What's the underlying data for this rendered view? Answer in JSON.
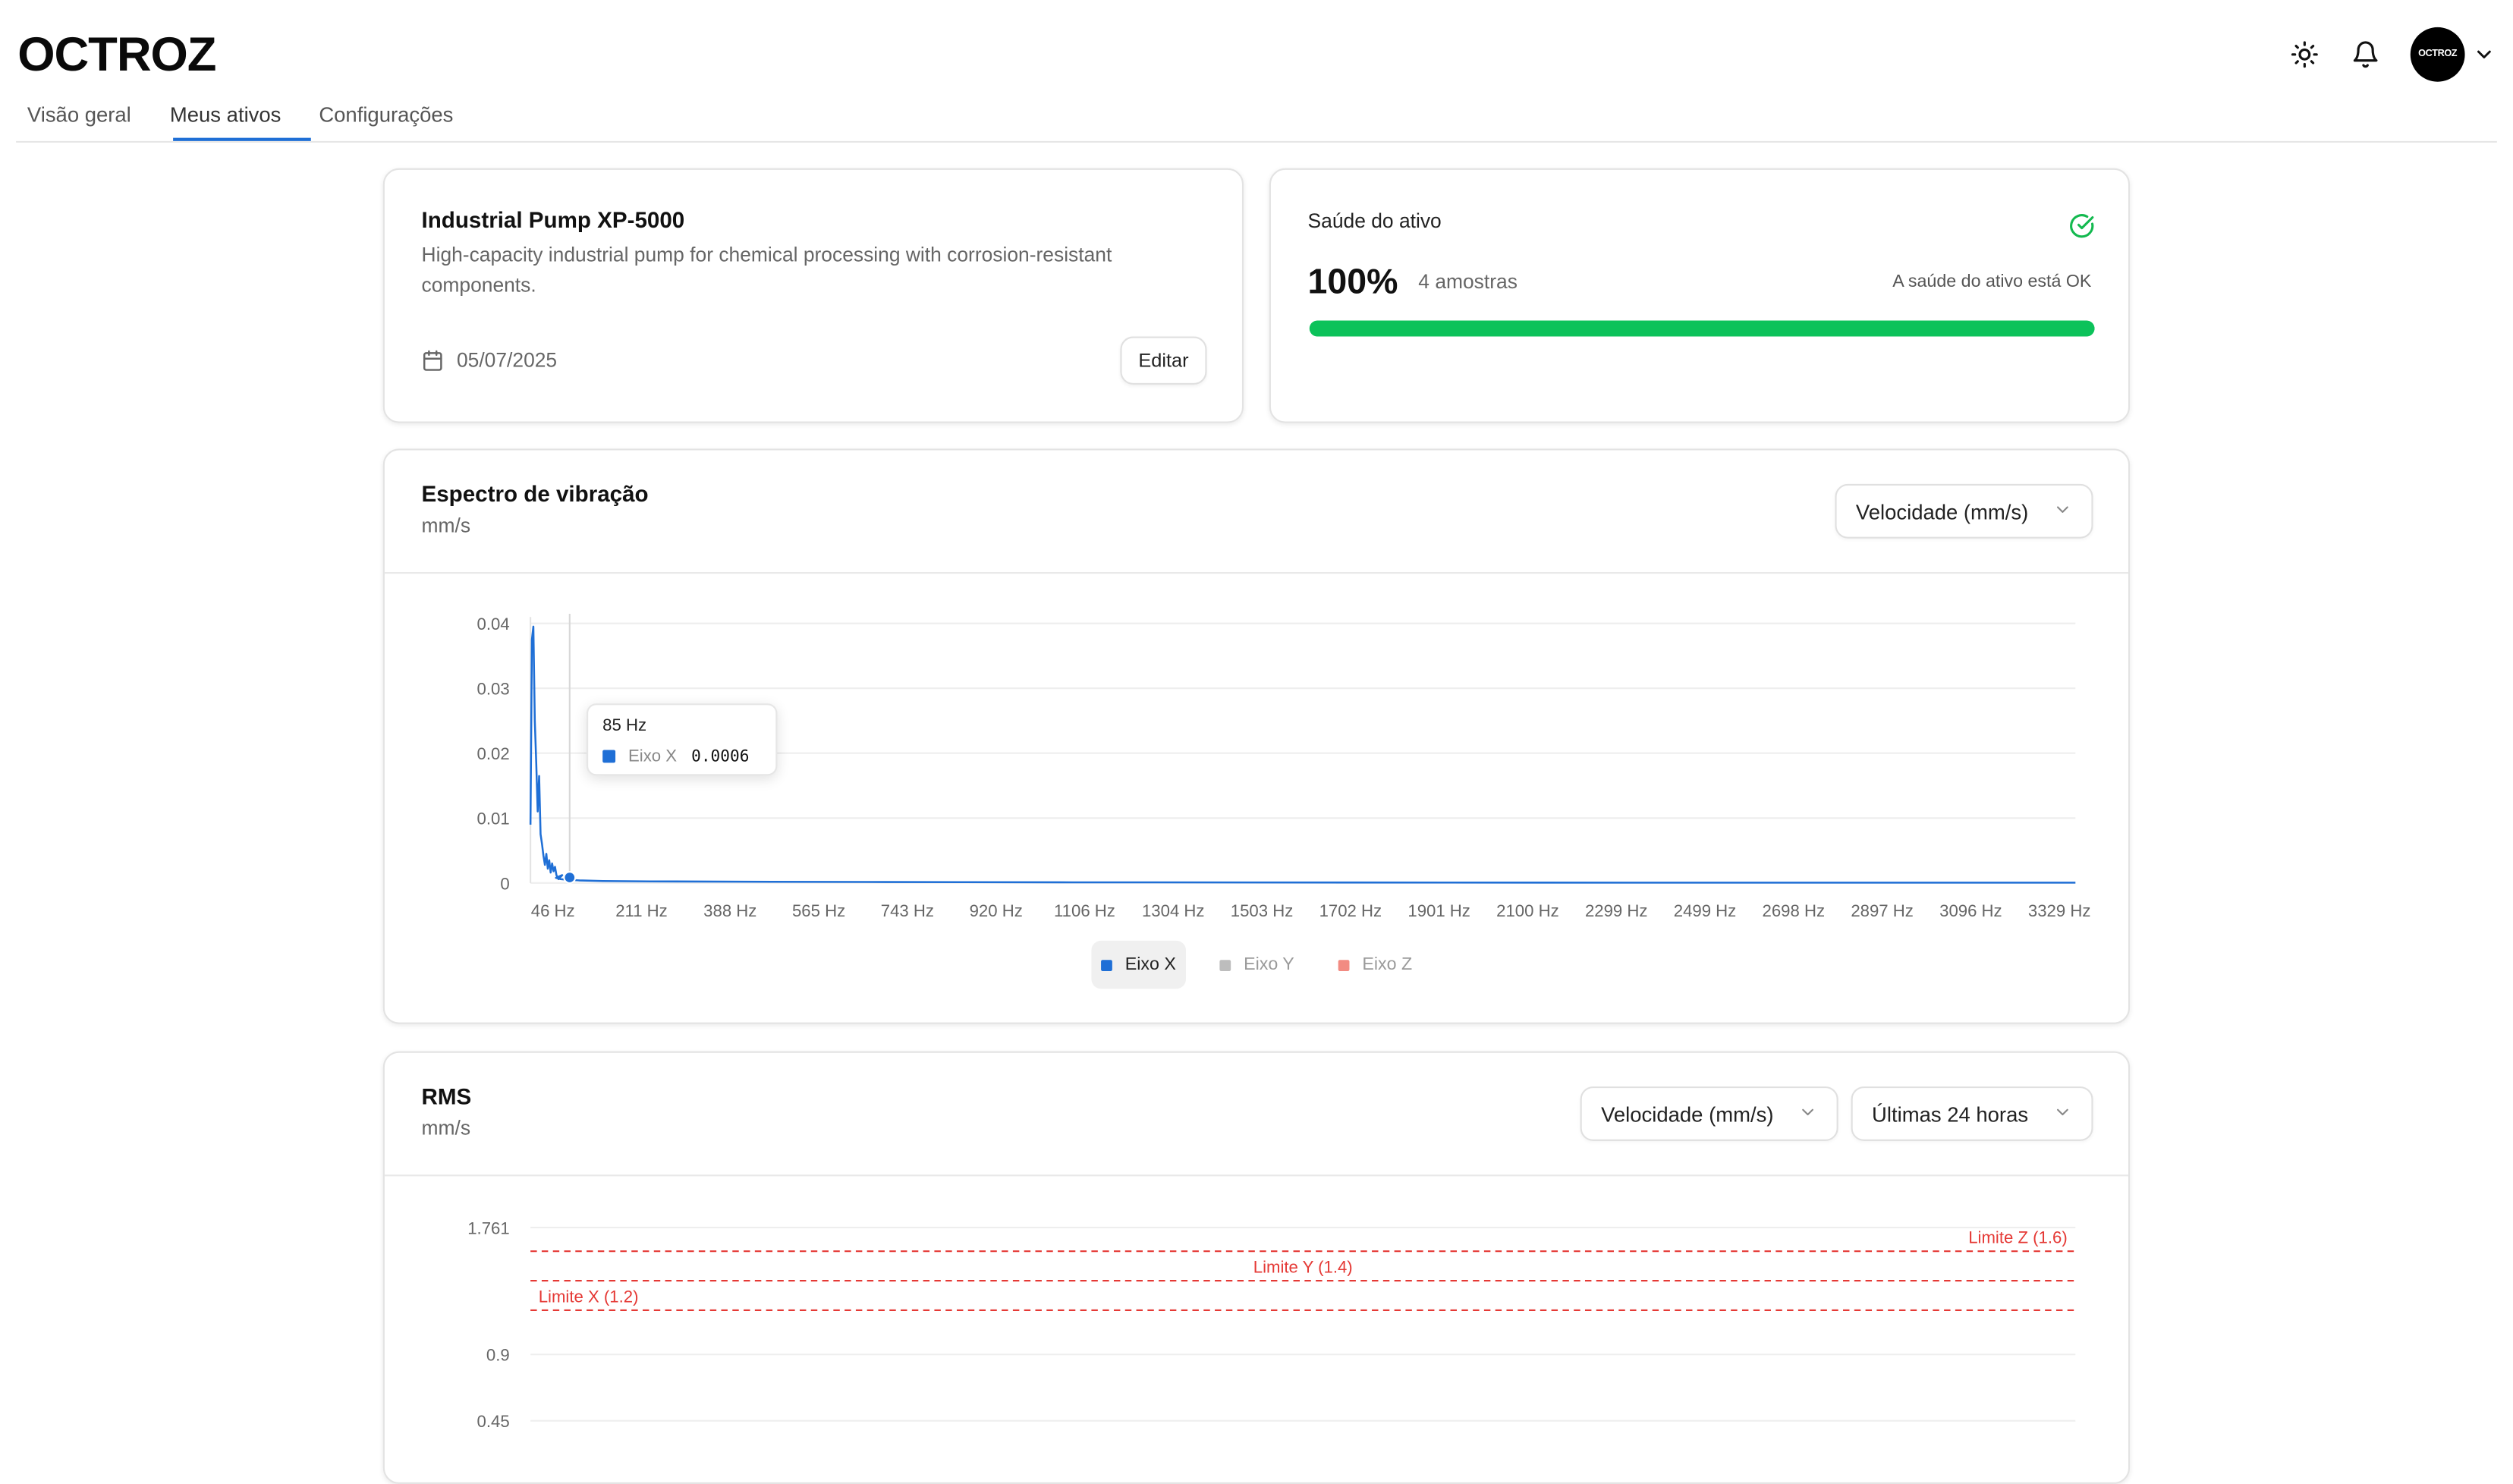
{
  "brand": {
    "logo": "OCTROZ",
    "avatar_text": "OCTROZ"
  },
  "header": {
    "icons": [
      "sun-icon",
      "bell-icon",
      "chevron-down-icon"
    ]
  },
  "tabs": [
    {
      "label": "Visão geral",
      "active": false
    },
    {
      "label": "Meus ativos",
      "active": true
    },
    {
      "label": "Configurações",
      "active": false
    }
  ],
  "asset": {
    "name": "Industrial Pump XP-5000",
    "description": "High-capacity industrial pump for chemical processing with corrosion-resistant components.",
    "date": "05/07/2025",
    "edit_label": "Editar"
  },
  "health": {
    "title": "Saúde do ativo",
    "percent_label": "100%",
    "percent": 100,
    "samples": "4 amostras",
    "status": "A saúde do ativo está OK",
    "color": "#0cc25a"
  },
  "spectrum": {
    "title": "Espectro de vibração",
    "unit": "mm/s",
    "select_value": "Velocidade (mm/s)",
    "tooltip": {
      "title": "85 Hz",
      "series": "Eixo X",
      "value": "0.0006"
    },
    "legend": [
      {
        "name": "Eixo X",
        "color": "#1f6fd6",
        "active": true
      },
      {
        "name": "Eixo Y",
        "color": "#bdbdbd",
        "active": false
      },
      {
        "name": "Eixo Z",
        "color": "#f28b82",
        "active": false
      }
    ]
  },
  "rms": {
    "title": "RMS",
    "unit": "mm/s",
    "metric_select": "Velocidade (mm/s)",
    "range_select": "Últimas 24 horas"
  },
  "chart_data": [
    {
      "type": "line",
      "x_tick_labels": [
        "46 Hz",
        "211 Hz",
        "388 Hz",
        "565 Hz",
        "743 Hz",
        "920 Hz",
        "1106 Hz",
        "1304 Hz",
        "1503 Hz",
        "1702 Hz",
        "1901 Hz",
        "2100 Hz",
        "2299 Hz",
        "2499 Hz",
        "2698 Hz",
        "2897 Hz",
        "3096 Hz",
        "3329 Hz"
      ],
      "y_ticks": [
        0,
        0.01,
        0.02,
        0.03,
        0.04
      ],
      "y_tick_labels": [
        "0",
        "0.01",
        "0.02",
        "0.03",
        "0.04"
      ],
      "xlim": [
        46,
        3329
      ],
      "ylim": [
        0,
        0.04
      ],
      "series": [
        {
          "name": "Eixo X",
          "color": "#1f6fd6",
          "x": [
            46,
            48,
            50,
            52,
            54,
            56,
            58,
            60,
            62,
            64,
            66,
            68,
            70,
            72,
            74,
            76,
            78,
            80,
            82,
            85,
            90,
            100,
            110,
            125,
            150,
            200,
            300,
            500,
            800,
            1200,
            1800,
            2500,
            3329
          ],
          "y": [
            0.009,
            0.0375,
            0.0395,
            0.025,
            0.0185,
            0.011,
            0.0165,
            0.0075,
            0.006,
            0.0042,
            0.0028,
            0.0045,
            0.0022,
            0.0035,
            0.0016,
            0.003,
            0.0018,
            0.0025,
            0.0012,
            0.0006,
            0.0012,
            0.0008,
            0.0006,
            0.0005,
            0.0004,
            0.0003,
            0.00025,
            0.0002,
            0.00015,
            0.0001,
            8e-05,
            6e-05,
            5e-05
          ]
        }
      ],
      "highlight": {
        "x": 85,
        "y": 0.0006
      },
      "legend_position": "bottom"
    },
    {
      "type": "line",
      "y_ticks": [
        0.45,
        0.9,
        1.761
      ],
      "y_tick_labels": [
        "0.45",
        "0.9",
        "1.761"
      ],
      "ylim": [
        0,
        1.761
      ],
      "threshold_lines": [
        {
          "label": "Limite X (1.2)",
          "value": 1.2,
          "color": "#e53935"
        },
        {
          "label": "Limite Y (1.4)",
          "value": 1.4,
          "color": "#e53935"
        },
        {
          "label": "Limite Z (1.6)",
          "value": 1.6,
          "color": "#e53935"
        }
      ]
    }
  ]
}
